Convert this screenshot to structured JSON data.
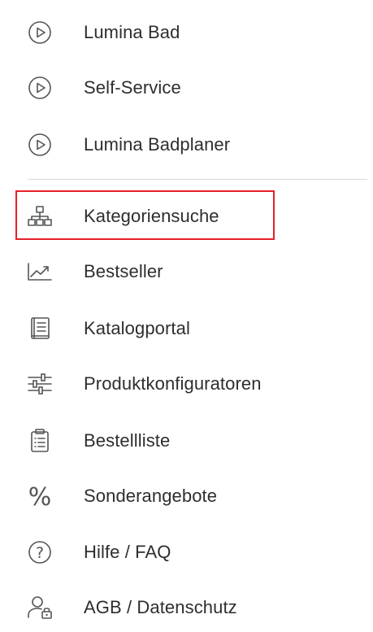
{
  "menu": {
    "items": [
      {
        "label": "Lumina Bad",
        "icon": "play-circle-icon"
      },
      {
        "label": "Self-Service",
        "icon": "play-circle-icon"
      },
      {
        "label": "Lumina Badplaner",
        "icon": "play-circle-icon"
      },
      {
        "label": "Kategoriensuche",
        "icon": "sitemap-icon",
        "highlighted": true
      },
      {
        "label": "Bestseller",
        "icon": "trend-chart-icon"
      },
      {
        "label": "Katalogportal",
        "icon": "book-icon"
      },
      {
        "label": "Produktkonfiguratoren",
        "icon": "sliders-icon"
      },
      {
        "label": "Bestellliste",
        "icon": "clipboard-list-icon"
      },
      {
        "label": "Sonderangebote",
        "icon": "percent-icon",
        "glyph": "%"
      },
      {
        "label": "Hilfe / FAQ",
        "icon": "help-circle-icon",
        "glyph": "?"
      },
      {
        "label": "AGB / Datenschutz",
        "icon": "user-lock-icon"
      }
    ]
  },
  "colors": {
    "text": "#2e2e2e",
    "icon": "#555555",
    "divider": "#d9d9d9",
    "highlight_border": "#e8202a"
  }
}
